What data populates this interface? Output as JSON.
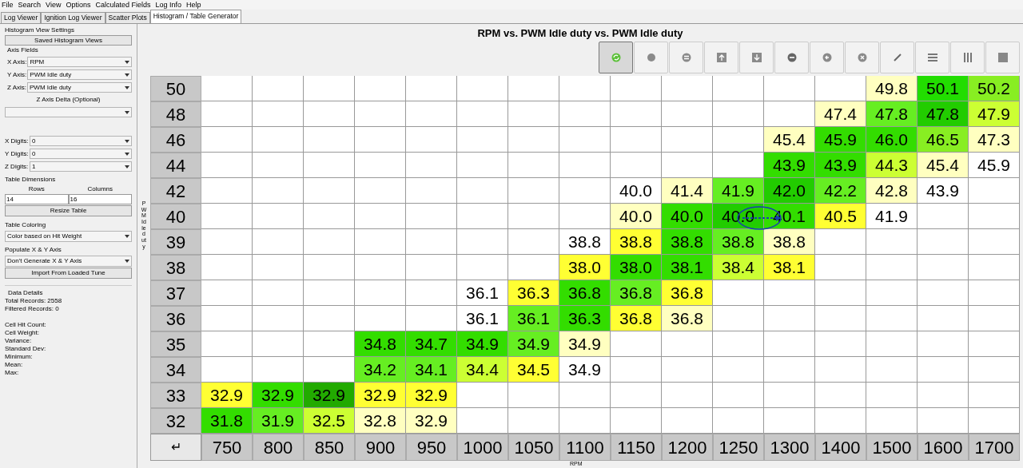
{
  "menu": [
    "File",
    "Search",
    "View",
    "Options",
    "Calculated Fields",
    "Log Info",
    "Help"
  ],
  "tabs": [
    {
      "label": "Log Viewer",
      "selected": false
    },
    {
      "label": "Ignition Log Viewer",
      "selected": false
    },
    {
      "label": "Scatter Plots",
      "selected": false
    },
    {
      "label": "Histogram / Table Generator",
      "selected": true
    }
  ],
  "settings": {
    "title": "Histogram View Settings",
    "saved_views_button": "Saved Histogram Views",
    "axis_fields_label": "Axis Fields",
    "axes": [
      {
        "label": "X Axis:",
        "value": "RPM"
      },
      {
        "label": "Y Axis:",
        "value": "PWM Idle duty"
      },
      {
        "label": "Z Axis:",
        "value": "PWM Idle duty"
      }
    ],
    "z_delta_label": "Z Axis Delta (Optional)",
    "digits": [
      {
        "label": "X Digits:",
        "value": "0"
      },
      {
        "label": "Y Digits:",
        "value": "0"
      },
      {
        "label": "Z Digits:",
        "value": "1"
      }
    ],
    "table_dimensions_label": "Table Dimensions",
    "rows_label": "Rows",
    "columns_label": "Columns",
    "rows_value": "14",
    "columns_value": "16",
    "resize_button": "Resize Table",
    "coloring_label": "Table Coloring",
    "coloring_value": "Color based on Hit Weight",
    "populate_label": "Populate X & Y Axis",
    "populate_value": "Don't Generate X & Y Axis",
    "import_button": "Import From Loaded Tune",
    "data_details_label": "Data Details",
    "details": [
      "Total Records: 2558",
      "Filtered Records: 0"
    ],
    "stats": [
      "Cell Hit Count:",
      "Cell Weight:",
      "Variance:",
      "Standard Dev:",
      "Minimum:",
      "Mean:",
      "Max:"
    ]
  },
  "chart_title": "RPM vs. PWM Idle duty vs. PWM Idle duty",
  "toolbar": [
    {
      "kind": "refresh",
      "selected": true
    },
    {
      "kind": "dot",
      "selected": false
    },
    {
      "kind": "equals",
      "selected": false
    },
    {
      "kind": "up",
      "selected": false
    },
    {
      "kind": "down",
      "selected": false
    },
    {
      "kind": "minus",
      "selected": false
    },
    {
      "kind": "left",
      "selected": false
    },
    {
      "kind": "clear",
      "selected": false
    },
    {
      "kind": "pencil",
      "selected": false
    },
    {
      "kind": "rows",
      "selected": false
    },
    {
      "kind": "columns",
      "selected": false
    },
    {
      "kind": "square",
      "selected": false
    }
  ],
  "y_axis_label": "PWM Idle duty",
  "table": {
    "rows": [
      {
        "label": "50",
        "cells": [
          null,
          null,
          null,
          null,
          null,
          null,
          null,
          null,
          null,
          null,
          null,
          null,
          null,
          {
            "value": "49.8",
            "color": "#ffffc0"
          },
          {
            "value": "50.1",
            "color": "#22dd00"
          },
          {
            "value": "50.2",
            "color": "#88ee22"
          }
        ]
      },
      {
        "label": "48",
        "cells": [
          null,
          null,
          null,
          null,
          null,
          null,
          null,
          null,
          null,
          null,
          null,
          null,
          {
            "value": "47.4",
            "color": "#ffffc0"
          },
          {
            "value": "47.8",
            "color": "#66ee22"
          },
          {
            "value": "47.8",
            "color": "#22cc00"
          },
          {
            "value": "47.9",
            "color": "#ccff33"
          }
        ]
      },
      {
        "label": "46",
        "cells": [
          null,
          null,
          null,
          null,
          null,
          null,
          null,
          null,
          null,
          null,
          null,
          {
            "value": "45.4",
            "color": "#ffffc0"
          },
          {
            "value": "45.9",
            "color": "#33dd00"
          },
          {
            "value": "46.0",
            "color": "#33dd00"
          },
          {
            "value": "46.5",
            "color": "#88ee22"
          },
          {
            "value": "47.3",
            "color": "#ffffc0"
          }
        ]
      },
      {
        "label": "44",
        "cells": [
          null,
          null,
          null,
          null,
          null,
          null,
          null,
          null,
          null,
          null,
          null,
          {
            "value": "43.9",
            "color": "#33dd00"
          },
          {
            "value": "43.9",
            "color": "#33dd00"
          },
          {
            "value": "44.3",
            "color": "#ccff33"
          },
          {
            "value": "45.4",
            "color": "#ffffc0"
          },
          {
            "value": "45.9",
            "color": "#ffffff"
          }
        ]
      },
      {
        "label": "42",
        "cells": [
          null,
          null,
          null,
          null,
          null,
          null,
          null,
          null,
          {
            "value": "40.0",
            "color": "#ffffff"
          },
          {
            "value": "41.4",
            "color": "#ffffc0"
          },
          {
            "value": "41.9",
            "color": "#66ee22"
          },
          {
            "value": "42.0",
            "color": "#22cc00"
          },
          {
            "value": "42.2",
            "color": "#66ee22"
          },
          {
            "value": "42.8",
            "color": "#ffffc0"
          },
          {
            "value": "43.9",
            "color": "#ffffff"
          },
          null
        ]
      },
      {
        "label": "40",
        "cells": [
          null,
          null,
          null,
          null,
          null,
          null,
          null,
          null,
          {
            "value": "40.0",
            "color": "#ffffc0"
          },
          {
            "value": "40.0",
            "color": "#33dd00"
          },
          {
            "value": "40.0",
            "color": "#22cc00"
          },
          {
            "value": "40.1",
            "color": "#33dd00"
          },
          {
            "value": "40.5",
            "color": "#ffff33"
          },
          {
            "value": "41.9",
            "color": "#ffffff"
          },
          null,
          null
        ]
      },
      {
        "label": "39",
        "cells": [
          null,
          null,
          null,
          null,
          null,
          null,
          null,
          {
            "value": "38.8",
            "color": "#ffffff"
          },
          {
            "value": "38.8",
            "color": "#ffff33"
          },
          {
            "value": "38.8",
            "color": "#33dd00"
          },
          {
            "value": "38.8",
            "color": "#66ee22"
          },
          {
            "value": "38.8",
            "color": "#ffffc0"
          },
          null,
          null,
          null,
          null
        ]
      },
      {
        "label": "38",
        "cells": [
          null,
          null,
          null,
          null,
          null,
          null,
          null,
          {
            "value": "38.0",
            "color": "#ffff33"
          },
          {
            "value": "38.0",
            "color": "#33dd00"
          },
          {
            "value": "38.1",
            "color": "#33dd00"
          },
          {
            "value": "38.4",
            "color": "#ccff33"
          },
          {
            "value": "38.1",
            "color": "#ffff33"
          },
          null,
          null,
          null,
          null
        ]
      },
      {
        "label": "37",
        "cells": [
          null,
          null,
          null,
          null,
          null,
          {
            "value": "36.1",
            "color": "#ffffff"
          },
          {
            "value": "36.3",
            "color": "#ffff33"
          },
          {
            "value": "36.8",
            "color": "#33dd00"
          },
          {
            "value": "36.8",
            "color": "#66ee22"
          },
          {
            "value": "36.8",
            "color": "#ffff33"
          },
          null,
          null,
          null,
          null,
          null,
          null
        ]
      },
      {
        "label": "36",
        "cells": [
          null,
          null,
          null,
          null,
          null,
          {
            "value": "36.1",
            "color": "#ffffff"
          },
          {
            "value": "36.1",
            "color": "#66ee22"
          },
          {
            "value": "36.3",
            "color": "#33dd00"
          },
          {
            "value": "36.8",
            "color": "#ffff33"
          },
          {
            "value": "36.8",
            "color": "#ffffc0"
          },
          null,
          null,
          null,
          null,
          null,
          null
        ]
      },
      {
        "label": "35",
        "cells": [
          null,
          null,
          null,
          {
            "value": "34.8",
            "color": "#33dd00"
          },
          {
            "value": "34.7",
            "color": "#33dd00"
          },
          {
            "value": "34.9",
            "color": "#33dd00"
          },
          {
            "value": "34.9",
            "color": "#66ee22"
          },
          {
            "value": "34.9",
            "color": "#ffffc0"
          },
          null,
          null,
          null,
          null,
          null,
          null,
          null,
          null
        ]
      },
      {
        "label": "34",
        "cells": [
          null,
          null,
          null,
          {
            "value": "34.2",
            "color": "#66ee22"
          },
          {
            "value": "34.1",
            "color": "#66ee22"
          },
          {
            "value": "34.4",
            "color": "#ccff33"
          },
          {
            "value": "34.5",
            "color": "#ffff33"
          },
          {
            "value": "34.9",
            "color": "#ffffff"
          },
          null,
          null,
          null,
          null,
          null,
          null,
          null,
          null
        ]
      },
      {
        "label": "33",
        "cells": [
          {
            "value": "32.9",
            "color": "#ffff33"
          },
          {
            "value": "32.9",
            "color": "#33dd00"
          },
          {
            "value": "32.9",
            "color": "#22aa00"
          },
          {
            "value": "32.9",
            "color": "#ffff33"
          },
          {
            "value": "32.9",
            "color": "#ffff33"
          },
          null,
          null,
          null,
          null,
          null,
          null,
          null,
          null,
          null,
          null,
          null
        ]
      },
      {
        "label": "32",
        "cells": [
          {
            "value": "31.8",
            "color": "#33dd00"
          },
          {
            "value": "31.9",
            "color": "#66ee22"
          },
          {
            "value": "32.5",
            "color": "#ccff33"
          },
          {
            "value": "32.8",
            "color": "#ffffc0"
          },
          {
            "value": "32.9",
            "color": "#ffffc0"
          },
          null,
          null,
          null,
          null,
          null,
          null,
          null,
          null,
          null,
          null,
          null
        ]
      }
    ]
  },
  "x_axis": {
    "corner": "↵",
    "values": [
      "750",
      "800",
      "850",
      "900",
      "950",
      "1000",
      "1050",
      "1100",
      "1150",
      "1200",
      "1250",
      "1300",
      "1400",
      "1500",
      "1600",
      "1700"
    ]
  },
  "x_axis_label": "RPM"
}
